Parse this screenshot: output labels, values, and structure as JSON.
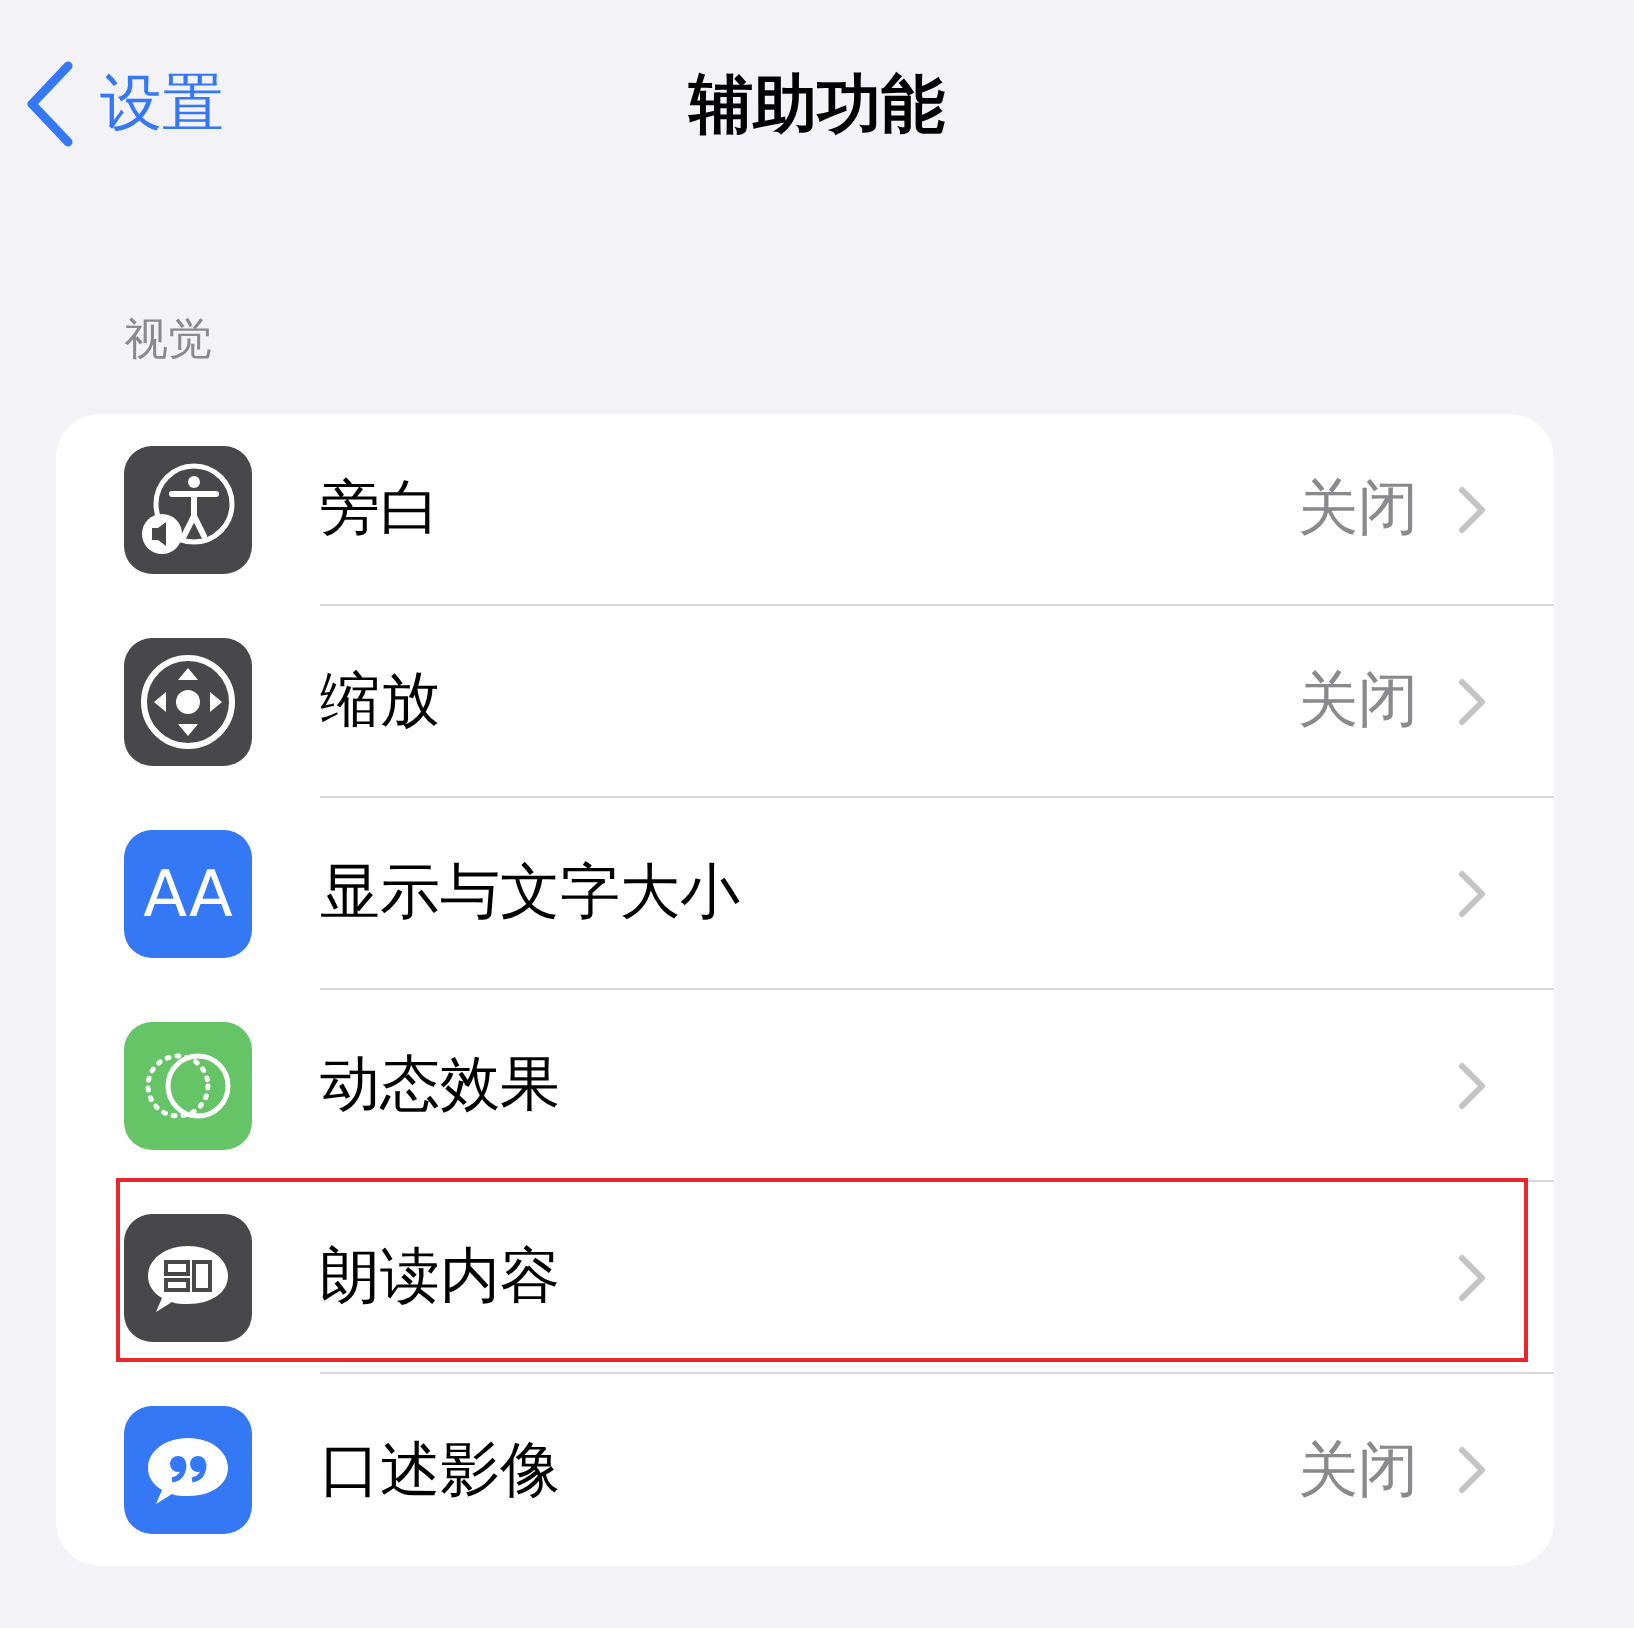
{
  "nav": {
    "back_label": "设置",
    "title": "辅助功能"
  },
  "section": {
    "header": "视觉",
    "rows": [
      {
        "kind": "voiceover",
        "label": "旁白",
        "value": "关闭",
        "highlighted": false
      },
      {
        "kind": "zoom",
        "label": "缩放",
        "value": "关闭",
        "highlighted": false
      },
      {
        "kind": "textsize",
        "icon_text": "AA",
        "label": "显示与文字大小",
        "highlighted": false
      },
      {
        "kind": "motion",
        "label": "动态效果",
        "highlighted": false
      },
      {
        "kind": "speech",
        "label": "朗读内容",
        "highlighted": true
      },
      {
        "kind": "description",
        "label": "口述影像",
        "value": "关闭",
        "highlighted": false
      }
    ]
  }
}
